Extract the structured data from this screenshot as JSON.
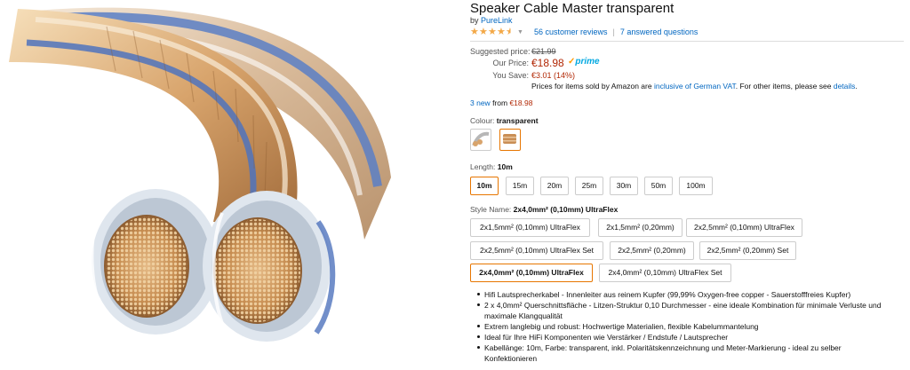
{
  "product": {
    "title": "Speaker Cable Master transparent",
    "by_prefix": "by",
    "brand": "PureLink",
    "rating_stars": 4.5,
    "reviews_link": "56 customer reviews",
    "questions_link": "7 answered questions",
    "image_icon": "speaker-cable-photo"
  },
  "pricing": {
    "suggested_label": "Suggested price:",
    "suggested_value": "€21.99",
    "our_price_label": "Our Price:",
    "our_price_value": "€18.98",
    "prime_check": "✓",
    "prime_label": "prime",
    "save_label": "You Save:",
    "save_value": "€3.01 (14%)",
    "vat_prefix": "Prices for items sold by Amazon are ",
    "vat_link": "inclusive of German VAT",
    "vat_middle": ". For other items, please see ",
    "vat_details": "details",
    "vat_end": "."
  },
  "offers": {
    "new_link": "3 new",
    "from_text": "from",
    "from_price": "€18.98"
  },
  "colour": {
    "label": "Colour:",
    "selected": "transparent"
  },
  "length": {
    "label": "Length:",
    "selected": "10m",
    "options": [
      "10m",
      "15m",
      "20m",
      "25m",
      "30m",
      "50m",
      "100m"
    ]
  },
  "style": {
    "label": "Style Name:",
    "selected": "2x4,0mm² (0,10mm) UltraFlex",
    "options": [
      "2x1,5mm² (0,10mm) UltraFlex",
      "2x1,5mm² (0,20mm)",
      "2x2,5mm² (0,10mm) UltraFlex",
      "2x2,5mm² (0,10mm) UltraFlex Set",
      "2x2,5mm² (0,20mm)",
      "2x2,5mm² (0,20mm) Set",
      "2x4,0mm² (0,10mm) UltraFlex",
      "2x4,0mm² (0,10mm) UltraFlex Set"
    ]
  },
  "bullets": [
    "Hifi Lautsprecherkabel - Innenleiter aus reinem Kupfer (99,99% Oxygen-free copper - Sauerstofffreies Kupfer)",
    "2 x 4,0mm² Querschnittsfläche - Litzen-Struktur 0,10 Durchmesser - eine ideale Kombination für minimale Verluste und maximale Klangqualität",
    "Extrem langlebig und robust: Hochwertige Materialien, flexible Kabelummantelung",
    "Ideal für Ihre HiFi Komponenten wie Verstärker / Endstufe / Lautsprecher",
    "Kabellänge: 10m, Farbe: transparent, inkl. Polaritätskennzeichnung und Meter-Markierung - ideal zu selber Konfektionieren"
  ],
  "colors": {
    "link": "#0066c0",
    "price": "#b12704",
    "star": "#f3a847",
    "selected_border": "#e77600",
    "prime": "#00a8e1"
  }
}
